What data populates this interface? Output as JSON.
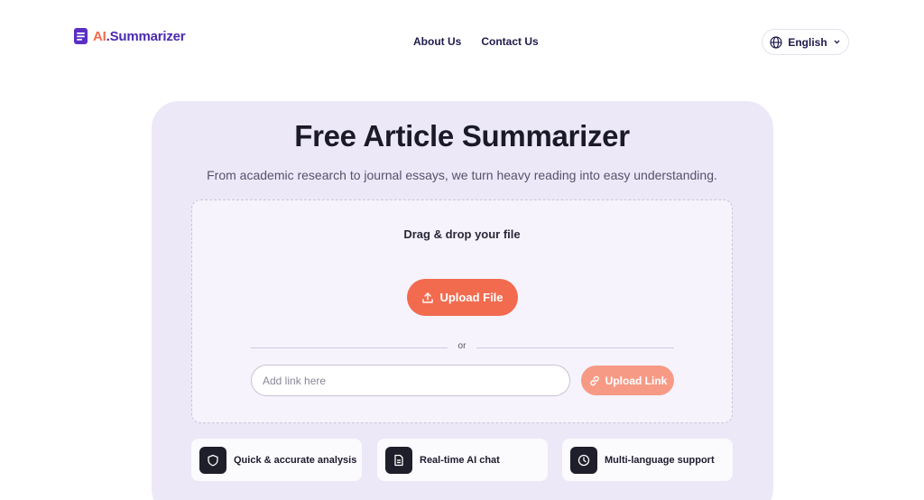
{
  "header": {
    "logo_ai": "AI",
    "logo_rest": ".Summarizer",
    "nav": [
      {
        "label": "About Us"
      },
      {
        "label": "Contact Us"
      }
    ],
    "language": {
      "label": "English",
      "icon": "globe-icon"
    }
  },
  "hero": {
    "title": "Free Article Summarizer",
    "subtitle": "From academic research to journal essays, we turn heavy reading into easy understanding."
  },
  "dropzone": {
    "label": "Drag & drop your file",
    "upload_button": "Upload File",
    "or_text": "or",
    "link_placeholder": "Add link here",
    "link_button": "Upload Link"
  },
  "features": [
    {
      "label": "Quick & accurate analysis",
      "icon": "shield-icon"
    },
    {
      "label": "Real-time AI chat",
      "icon": "document-icon"
    },
    {
      "label": "Multi-language support",
      "icon": "clock-icon"
    }
  ],
  "colors": {
    "accent": "#f26b4f",
    "brand": "#4b2bb0",
    "card_bg": "#ede8f8"
  }
}
